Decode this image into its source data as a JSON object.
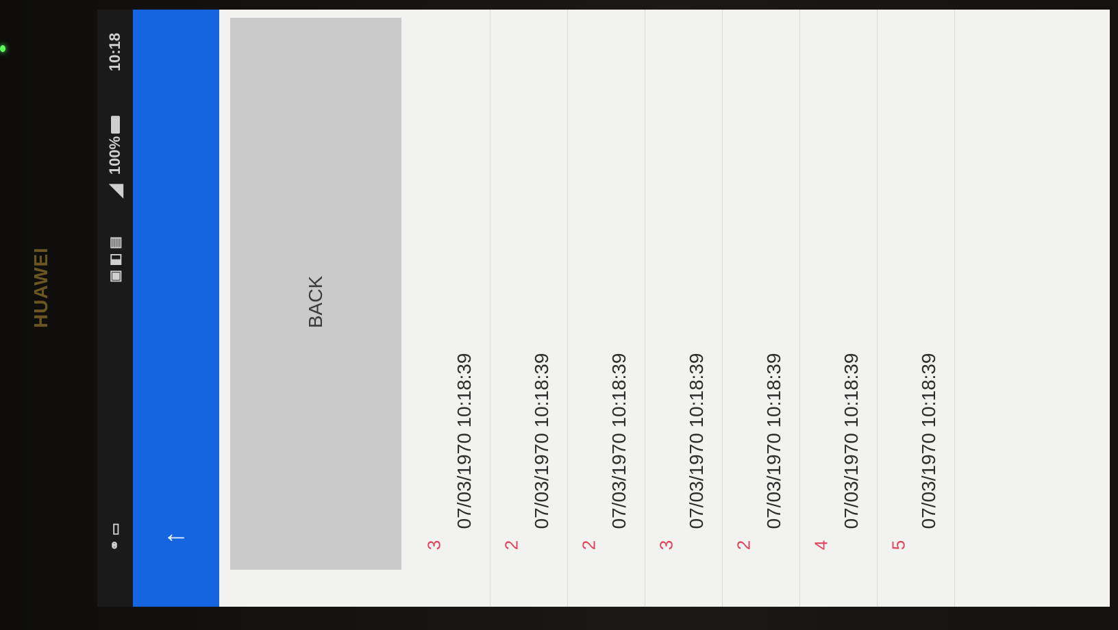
{
  "device": {
    "brand": "HUAWEI"
  },
  "status_bar": {
    "time": "10:18",
    "battery": "100%",
    "battery_icon": "battery-full-icon",
    "signal_icon": "signal-icon",
    "left_icons": "usb-icon",
    "right_icons": "notification-icons"
  },
  "app_bar": {
    "nav_icon": "arrow-back-icon",
    "nav_glyph": "←",
    "color": "#1565e0"
  },
  "actions": {
    "back_label": "BACK"
  },
  "list": {
    "count_color": "#e0455f",
    "items": [
      {
        "count": "3",
        "timestamp": "07/03/1970 10:18:39"
      },
      {
        "count": "2",
        "timestamp": "07/03/1970 10:18:39"
      },
      {
        "count": "2",
        "timestamp": "07/03/1970 10:18:39"
      },
      {
        "count": "3",
        "timestamp": "07/03/1970 10:18:39"
      },
      {
        "count": "2",
        "timestamp": "07/03/1970 10:18:39"
      },
      {
        "count": "4",
        "timestamp": "07/03/1970 10:18:39"
      },
      {
        "count": "5",
        "timestamp": "07/03/1970 10:18:39"
      }
    ]
  }
}
